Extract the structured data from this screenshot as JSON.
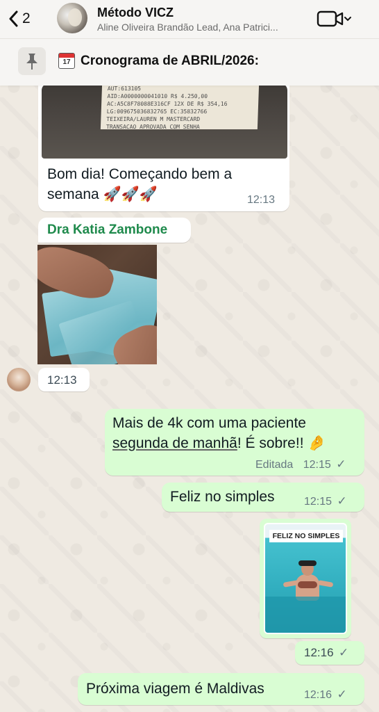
{
  "header": {
    "back_count": "2",
    "title": "Método VICZ",
    "subtitle": "Aline Oliveira Brandão Lead, Ana Patrici..."
  },
  "pinned": {
    "calendar_text": "17",
    "text": "Cronograma de ABRIL/2026:"
  },
  "receipt": {
    "lines": [
      "AUT:613105",
      "AID:A0000000041010   R$ 4.250,00",
      "AC:A5C8F78088E316CF  12X DE R$ 354,16",
      "LG:009675036832765   EC:35832766",
      "TEIXEIRA/LAUREN M        MASTERCARD",
      "     TRANSACAO APROVADA COM SENHA"
    ]
  },
  "messages": [
    {
      "id": "m1",
      "direction": "incoming",
      "text_line1": "Bom dia! Começando bem a",
      "text_line2": "semana 🚀🚀🚀",
      "time": "12:13"
    },
    {
      "id": "m2",
      "direction": "incoming",
      "sender": "Dra Katia Zambone",
      "type": "image",
      "time": "12:13"
    },
    {
      "id": "m3",
      "direction": "outgoing",
      "text_line1": "Mais de 4k com uma paciente",
      "text_line2a": "segunda de manhã",
      "text_line2b": "! É sobre!! 🤌",
      "edited_label": "Editada",
      "time": "12:15",
      "status": "read"
    },
    {
      "id": "m4",
      "direction": "outgoing",
      "text": "Feliz no simples",
      "time": "12:15",
      "status": "read"
    },
    {
      "id": "m5",
      "direction": "outgoing",
      "type": "image",
      "image_caption": "FELIZ NO SIMPLES",
      "time": "12:16",
      "status": "read"
    },
    {
      "id": "m6",
      "direction": "outgoing",
      "text": "Próxima viagem é Maldivas",
      "time": "12:16",
      "status": "read"
    }
  ],
  "colors": {
    "incoming_bubble": "#ffffff",
    "outgoing_bubble": "#d9fdd3",
    "sender_name": "#1f8a4c",
    "background": "#efeae2"
  },
  "icons": {
    "back": "chevron-left-icon",
    "video": "video-camera-icon",
    "pin": "pin-icon",
    "calendar": "calendar-icon",
    "check": "checkmark-icon"
  }
}
